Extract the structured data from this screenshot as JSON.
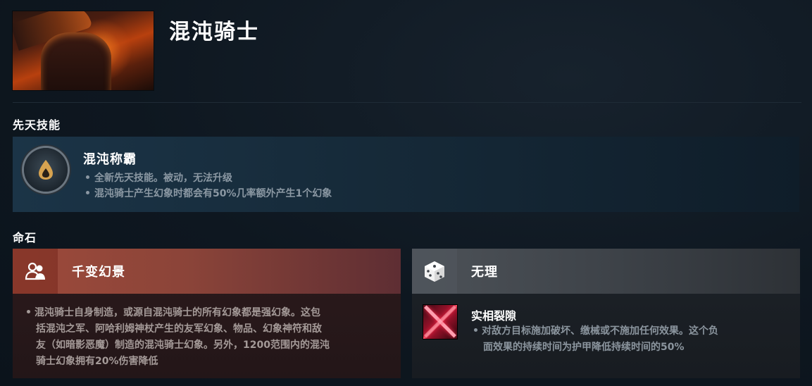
{
  "hero": {
    "name": "混沌骑士",
    "portrait_icon": "chaos-knight-portrait"
  },
  "innate_section": {
    "title": "先天技能",
    "ability": {
      "name": "混沌称霸",
      "icon": "innate-ability-icon",
      "lines": [
        "全新先天技能。被动，无法升级",
        "混沌骑士产生幻象时都会有50%几率额外产生1个幻象"
      ]
    }
  },
  "facets_section": {
    "title": "命石",
    "facets": [
      {
        "name": "千变幻景",
        "icon": "people-icon",
        "color": "#9d4a3a",
        "text_line1": "混沌骑士自身制造，或源自混沌骑士的所有幻象都是强幻象。这包",
        "text_line2": "括混沌之军、阿哈利姆神杖产生的友军幻象、物品、幻象神符和敌",
        "text_line3": "友（如暗影恶魔）制造的混沌骑士幻象。另外，1200范围内的混沌",
        "text_line4": "骑士幻象拥有20%伤害降低"
      },
      {
        "name": "无理",
        "icon": "dice-icon",
        "color": "#4d5258",
        "sub_ability": {
          "name": "实相裂隙",
          "icon": "reality-rift-icon",
          "line1": "对敌方目标施加破坏、缴械或不施加任何效果。这个负",
          "line2": "面效果的持续时间为护甲降低持续时间的50%"
        }
      }
    ]
  }
}
